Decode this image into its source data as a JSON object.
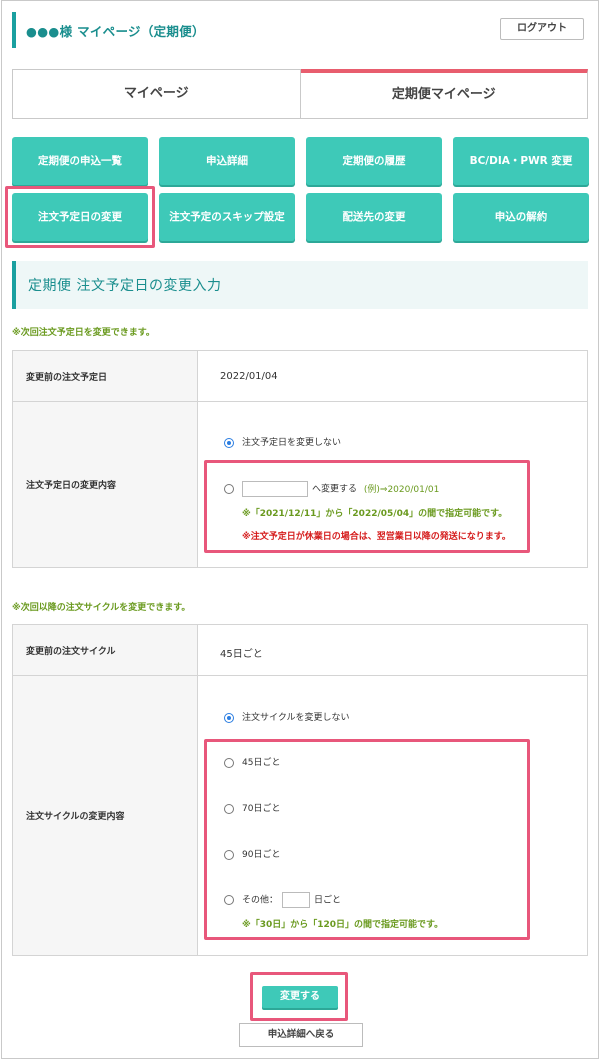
{
  "header": {
    "title": "●●●様 マイページ（定期便）",
    "logout_label": "ログアウト"
  },
  "tabs": [
    {
      "label": "マイページ",
      "active": false
    },
    {
      "label": "定期便マイページ",
      "active": true
    }
  ],
  "menu": {
    "row1": [
      "定期便の申込一覧",
      "申込詳細",
      "定期便の履歴",
      "BC/DIA・PWR 変更"
    ],
    "row2": [
      "注文予定日の変更",
      "注文予定のスキップ設定",
      "配送先の変更",
      "申込の解約"
    ]
  },
  "section_title": "定期便 注文予定日の変更入力",
  "date_section": {
    "note": "※次回注文予定日を変更できます。",
    "current_label": "変更前の注文予定日",
    "current_value": "2022/01/04",
    "change_label": "注文予定日の変更内容",
    "option_no_change": "注文予定日を変更しない",
    "option_change_suffix": "へ変更する",
    "example": "(例)⇒2020/01/01",
    "range_note": "※「2021/12/11」から「2022/05/04」の間で指定可能です。",
    "holiday_note": "※注文予定日が休業日の場合は、翌営業日以降の発送になります。"
  },
  "cycle_section": {
    "note": "※次回以降の注文サイクルを変更できます。",
    "current_label": "変更前の注文サイクル",
    "current_value": "45日ごと",
    "change_label": "注文サイクルの変更内容",
    "option_no_change": "注文サイクルを変更しない",
    "options": [
      "45日ごと",
      "70日ごと",
      "90日ごと"
    ],
    "other_prefix": "その他：",
    "other_suffix": "日ごと",
    "range_note": "※「30日」から「120日」の間で指定可能です。"
  },
  "actions": {
    "submit_label": "変更する",
    "back_label": "申込詳細へ戻る"
  },
  "colors": {
    "teal": "#3ec9b8",
    "heading_teal": "#1a8e8e",
    "highlight": "#e8577b",
    "tab_accent": "#e85d6e",
    "note_green": "#6a9a1f",
    "warning_red": "#d51c1c"
  }
}
